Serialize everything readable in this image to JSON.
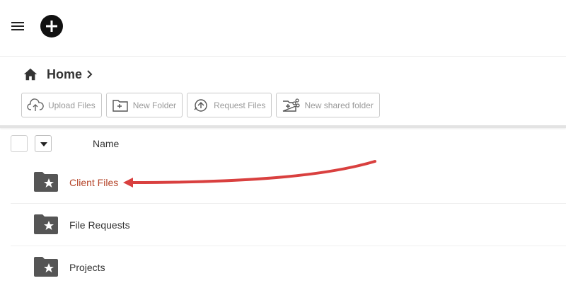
{
  "topbar": {
    "menu_icon": "hamburger-menu-icon",
    "add_icon": "plus-circle-icon"
  },
  "breadcrumb": {
    "home_icon": "home-icon",
    "label": "Home",
    "separator_icon": "chevron-right-icon"
  },
  "toolbar": {
    "buttons": [
      {
        "label": "Upload Files",
        "icon": "cloud-upload-icon"
      },
      {
        "label": "New Folder",
        "icon": "folder-plus-icon"
      },
      {
        "label": "Request Files",
        "icon": "request-files-icon"
      },
      {
        "label": "New shared folder",
        "icon": "shared-folder-icon"
      }
    ]
  },
  "list": {
    "column_name": "Name",
    "items": [
      {
        "name": "Client Files",
        "icon": "starred-folder-icon",
        "highlighted": true
      },
      {
        "name": "File Requests",
        "icon": "starred-folder-icon",
        "highlighted": false
      },
      {
        "name": "Projects",
        "icon": "starred-folder-icon",
        "highlighted": false
      }
    ]
  },
  "colors": {
    "highlight_text": "#b5452a",
    "annotation_arrow": "#d9403f",
    "folder_icon": "#555555"
  }
}
